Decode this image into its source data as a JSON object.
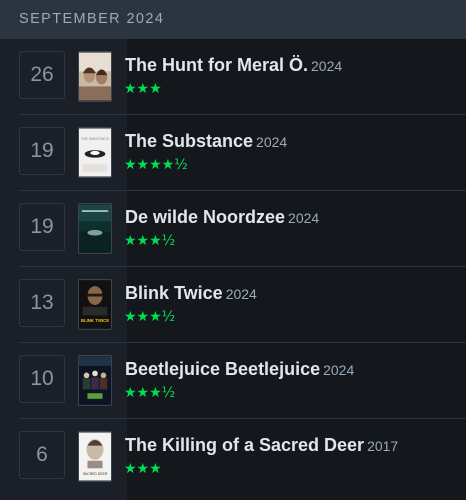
{
  "header": {
    "month": "SEPTEMBER 2024"
  },
  "diary": [
    {
      "day": "26",
      "title": "The Hunt for Meral Ö.",
      "year": "2024",
      "rating": "★★★",
      "stars": 3.0
    },
    {
      "day": "19",
      "title": "The Substance",
      "year": "2024",
      "rating": "★★★★½",
      "stars": 4.5
    },
    {
      "day": "19",
      "title": "De wilde Noordzee",
      "year": "2024",
      "rating": "★★★½",
      "stars": 3.5
    },
    {
      "day": "13",
      "title": "Blink Twice",
      "year": "2024",
      "rating": "★★★½",
      "stars": 3.5
    },
    {
      "day": "10",
      "title": "Beetlejuice Beetlejuice",
      "year": "2024",
      "rating": "★★★½",
      "stars": 3.5
    },
    {
      "day": "6",
      "title": "The Killing of a Sacred Deer",
      "year": "2017",
      "rating": "★★★",
      "stars": 3.0
    }
  ],
  "posters": [
    {
      "text": "",
      "icon": "poster-hunt-for-meral"
    },
    {
      "text": "THE SUBSTANCE",
      "icon": "poster-the-substance"
    },
    {
      "text": "",
      "icon": "poster-de-wilde-noordzee"
    },
    {
      "text": "BLINK TWICE",
      "icon": "poster-blink-twice"
    },
    {
      "text": "",
      "icon": "poster-beetlejuice"
    },
    {
      "text": "SACRED DEER",
      "icon": "poster-sacred-deer"
    }
  ],
  "colors": {
    "header_bg": "#2c3440",
    "background": "#14181c",
    "star_green": "#00e054",
    "title_text": "#dfe6ec"
  }
}
